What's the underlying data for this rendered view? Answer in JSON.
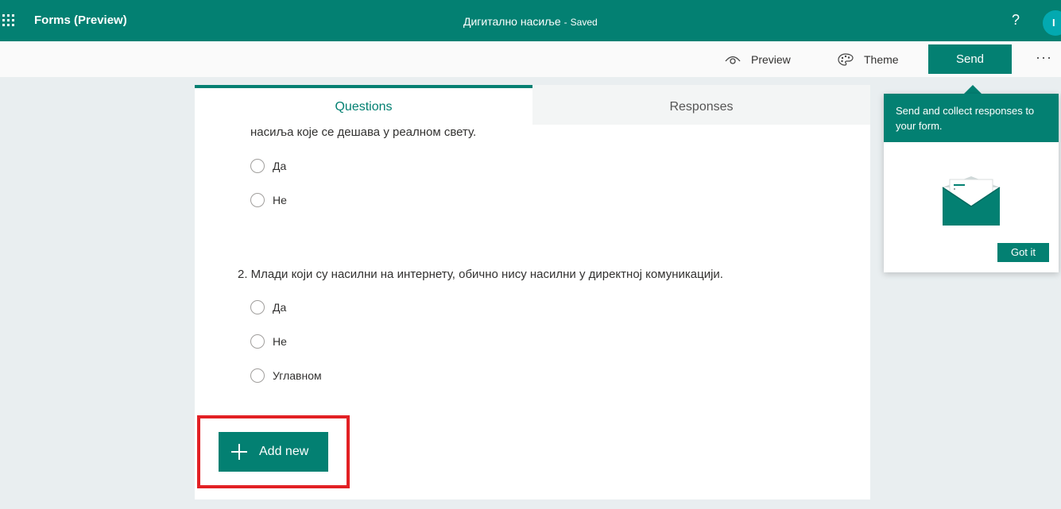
{
  "topbar": {
    "app_name": "Forms (Preview)",
    "doc_title": "Дигитално насиље",
    "separator": "-",
    "save_status": "Saved",
    "help": "?",
    "avatar_initial": "I"
  },
  "commands": {
    "preview": "Preview",
    "theme": "Theme",
    "send": "Send",
    "more": "···"
  },
  "tabs": {
    "questions": "Questions",
    "responses": "Responses"
  },
  "question1": {
    "text_tail": "насиља које се дешава у реалном свету.",
    "options": [
      "Да",
      "Не"
    ]
  },
  "question2": {
    "text": "2. Млади који су насилни на интернету, обично нису насилни у директној комуникацији.",
    "options": [
      "Да",
      "Не",
      "Углавном"
    ]
  },
  "add_new": {
    "label": "Add new"
  },
  "callout": {
    "message": "Send and collect responses to your form.",
    "button": "Got it"
  },
  "colors": {
    "brand": "#038072",
    "highlight": "#e22024",
    "page_bg": "#e9eef0"
  },
  "icons": [
    "app-launcher-icon",
    "preview-eye-icon",
    "theme-palette-icon",
    "more-icon",
    "plus-icon",
    "envelope-icon"
  ]
}
